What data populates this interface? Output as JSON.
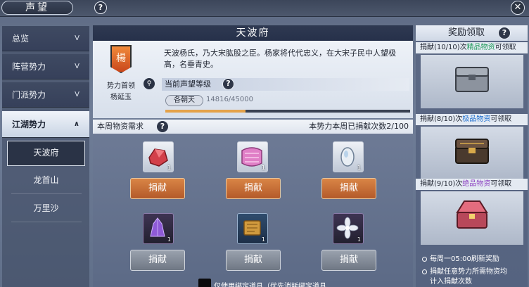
{
  "header": {
    "title": "声望",
    "help": "?",
    "close": "✕"
  },
  "sidebar": {
    "items": [
      {
        "label": "总览",
        "chev": "V"
      },
      {
        "label": "阵营势力",
        "chev": "V"
      },
      {
        "label": "门派势力",
        "chev": "V"
      },
      {
        "label": "江湖势力",
        "chev": "∧"
      }
    ],
    "subitems": [
      "天波府",
      "龙首山",
      "万里沙"
    ]
  },
  "faction": {
    "name": "天波府",
    "emblem": "楊",
    "leader_label": "势力首领",
    "leader_name": "杨延玉",
    "description": "天波杨氏，乃大宋肱股之臣。杨家将代代忠义，在大宋子民中人望极高，名垂青史。",
    "reputation_label": "当前声望等级",
    "rank": "各朝天",
    "progress_text": "14816/45000",
    "progress": 0.329
  },
  "requirements": {
    "label": "本周物资需求",
    "weekly": "本势力本周已捐献次数2/100",
    "items": [
      {
        "icon": "red-crystal-icon",
        "count": "1",
        "button": "捐献",
        "state": "active"
      },
      {
        "icon": "pink-fabric-icon",
        "count": "1",
        "button": "捐献",
        "state": "active"
      },
      {
        "icon": "white-stone-icon",
        "count": "1",
        "button": "捐献",
        "state": "active"
      },
      {
        "icon": "purple-crystal-icon",
        "count": "1",
        "button": "捐献",
        "state": "disabled"
      },
      {
        "icon": "scroll-icon",
        "count": "1",
        "button": "捐献",
        "state": "disabled"
      },
      {
        "icon": "silver-flower-icon",
        "count": "1",
        "button": "捐献",
        "state": "disabled"
      }
    ],
    "checkbox_label": "仅使用绑定道具（优先消耗绑定道具"
  },
  "rewards": {
    "title": "奖励领取",
    "tiers": [
      {
        "pre": "捐献(10/10)次",
        "grade": "精品物资",
        "post": "可领取",
        "grade_color": "#1f9a5a"
      },
      {
        "pre": "捐献(8/10)次",
        "grade": "极品物资",
        "post": "可领取",
        "grade_color": "#1e6fd0"
      },
      {
        "pre": "捐献(9/10)次",
        "grade": "绝品物资",
        "post": "可领取",
        "grade_color": "#8a3fc0"
      }
    ],
    "notes": [
      "每周一05:00刷新奖励",
      "捐献任意势力所需物资均",
      "计入捐献次数"
    ]
  }
}
